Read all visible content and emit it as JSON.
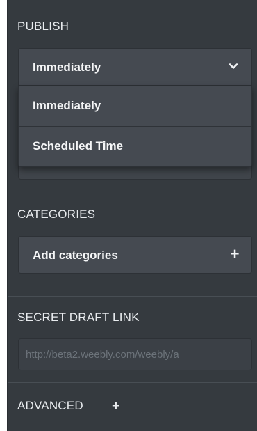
{
  "publish": {
    "title": "PUBLISH",
    "selected": "Immediately",
    "options": [
      "Immediately",
      "Scheduled Time"
    ]
  },
  "categories": {
    "title": "CATEGORIES",
    "add_label": "Add categories",
    "add_icon": "+"
  },
  "secret_draft_link": {
    "title": "SECRET DRAFT LINK",
    "value": "http://beta2.weebly.com/weebly/a"
  },
  "advanced": {
    "title": "ADVANCED",
    "toggle_icon": "+"
  },
  "icons": {
    "dropdown": "chevron-down-icon",
    "add": "plus-icon"
  }
}
